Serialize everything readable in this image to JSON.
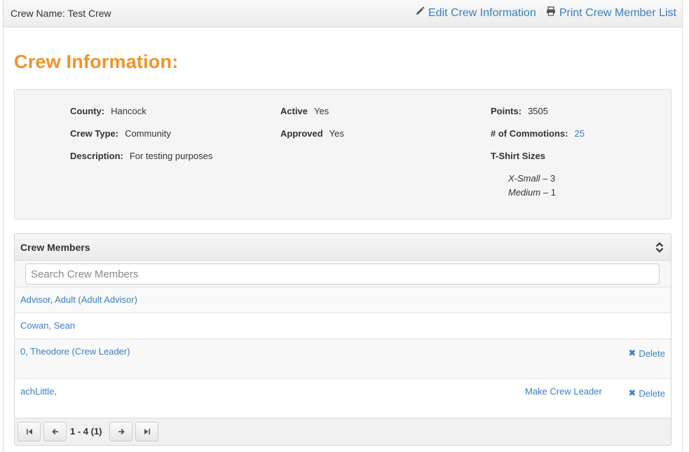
{
  "header": {
    "crew_label": "Crew Name:",
    "crew_name": "Test Crew",
    "edit_label": "Edit Crew Information",
    "print_label": "Print Crew Member List"
  },
  "section_title": "Crew Information:",
  "info": {
    "county": {
      "label": "County:",
      "value": "Hancock"
    },
    "crew_type": {
      "label": "Crew Type:",
      "value": "Community"
    },
    "description": {
      "label": "Description:",
      "value": "For testing purposes"
    },
    "active": {
      "label": "Active",
      "value": "Yes"
    },
    "approved": {
      "label": "Approved",
      "value": "Yes"
    },
    "points": {
      "label": "Points:",
      "value": "3505"
    },
    "commotions": {
      "label": "# of Commotions:",
      "value": "25"
    },
    "tshirt": {
      "label": "T-Shirt Sizes",
      "sizes": [
        {
          "size": "X-Small",
          "sep": " – ",
          "count": "3"
        },
        {
          "size": "Medium",
          "sep": " – ",
          "count": "1"
        }
      ]
    }
  },
  "members": {
    "title": "Crew Members",
    "search_placeholder": "Search Crew Members",
    "rows": [
      {
        "name": "Advisor, Adult (Adult Advisor)"
      },
      {
        "name": "Cowan, Sean"
      },
      {
        "name": "0, Theodore (Crew Leader)",
        "delete_label": "Delete"
      },
      {
        "name": "achLittle,",
        "make_leader_label": "Make Crew Leader",
        "delete_label": "Delete"
      }
    ],
    "pager_info": "1 - 4 (1)"
  },
  "colors": {
    "accent_orange": "#f0932b",
    "link_blue": "#3a7fc3"
  }
}
